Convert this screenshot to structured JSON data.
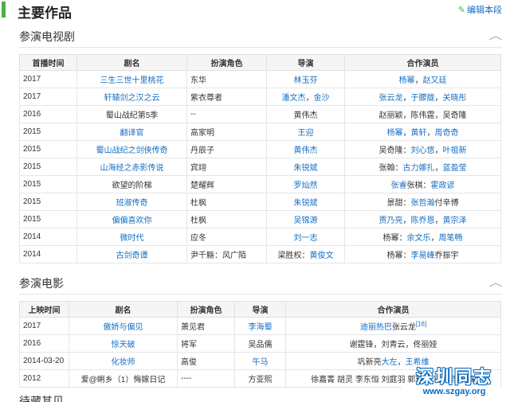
{
  "section_title": "主要作品",
  "edit_label": "编辑本段",
  "tv": {
    "heading": "参演电视剧",
    "headers": [
      "首播时间",
      "剧名",
      "扮演角色",
      "导演",
      "合作演员"
    ],
    "rows": [
      {
        "year": "2017",
        "title": "三生三世十里桃花",
        "title_link": true,
        "role": "东华",
        "director": [
          {
            "t": "林玉芬",
            "l": true
          }
        ],
        "costars": [
          {
            "t": "杨幂",
            "l": true
          },
          {
            "t": "赵又廷",
            "l": true
          }
        ]
      },
      {
        "year": "2017",
        "title": "轩辕剑之汉之云",
        "title_link": true,
        "role": "紫衣尊者",
        "director": [
          {
            "t": "潘文杰",
            "l": true
          },
          {
            "t": "金沙",
            "l": true
          }
        ],
        "costars": [
          {
            "t": "张云龙",
            "l": true
          },
          {
            "t": "于朦胧",
            "l": true
          },
          {
            "t": "关晓彤",
            "l": true
          }
        ]
      },
      {
        "year": "2016",
        "title": "蜀山战纪第5季",
        "title_link": false,
        "role": "--",
        "director": [
          {
            "t": "黄伟杰",
            "l": false
          }
        ],
        "costars": [
          {
            "t": "赵丽颖，陈伟霆，吴奇隆",
            "l": false
          }
        ]
      },
      {
        "year": "2015",
        "title": "翻译官",
        "title_link": true,
        "role": "高家明",
        "director": [
          {
            "t": "王迎",
            "l": true
          }
        ],
        "costars": [
          {
            "t": "杨幂",
            "l": true
          },
          {
            "t": "黄轩",
            "l": true
          },
          {
            "t": "周奇奇",
            "l": true
          }
        ]
      },
      {
        "year": "2015",
        "title": "蜀山战纪之剑侠传奇",
        "title_link": true,
        "role": "丹辰子",
        "director": [
          {
            "t": "黄伟杰",
            "l": true
          }
        ],
        "costars": [
          {
            "t": "吴奇隆：",
            "l": false
          },
          {
            "t": "刘心悠",
            "l": true
          },
          {
            "t": "叶祖新",
            "l": true
          }
        ]
      },
      {
        "year": "2015",
        "title": "山海经之赤影传说",
        "title_link": true,
        "role": "宾翊",
        "director": [
          {
            "t": "朱锐斌",
            "l": true
          }
        ],
        "costars": [
          {
            "t": "张翰：",
            "l": false
          },
          {
            "t": "古力娜扎",
            "l": true
          },
          {
            "t": "蓝盈莹",
            "l": true
          }
        ]
      },
      {
        "year": "2015",
        "title": "欲望的阶梯",
        "title_link": false,
        "role": "楚耀辉",
        "director": [
          {
            "t": "罗灿然",
            "l": true
          }
        ],
        "costars": [
          {
            "t": "张睿",
            "l": true
          },
          {
            "t": "张棋：",
            "l": false
          },
          {
            "t": "霍政谚",
            "l": true
          }
        ]
      },
      {
        "year": "2015",
        "title": "班淑传奇",
        "title_link": true,
        "role": "杜枫",
        "director": [
          {
            "t": "朱锐斌",
            "l": true
          }
        ],
        "costars": [
          {
            "t": "景甜：",
            "l": false
          },
          {
            "t": "张哲瀚",
            "l": true
          },
          {
            "t": "付辛博",
            "l": false
          }
        ]
      },
      {
        "year": "2015",
        "title": "偏偏喜欢你",
        "title_link": true,
        "role": "杜枫",
        "director": [
          {
            "t": "吴锦源",
            "l": true
          }
        ],
        "costars": [
          {
            "t": "贾乃亮",
            "l": true
          },
          {
            "t": "陈乔恩",
            "l": true
          },
          {
            "t": "黄宗泽",
            "l": true
          }
        ]
      },
      {
        "year": "2014",
        "title": "微时代",
        "title_link": true,
        "role": "应冬",
        "director": [
          {
            "t": "刘一志",
            "l": true
          }
        ],
        "costars": [
          {
            "t": "杨幂：",
            "l": false
          },
          {
            "t": "余文乐",
            "l": true
          },
          {
            "t": "周笔畅",
            "l": true
          }
        ]
      },
      {
        "year": "2014",
        "title": "古剑奇谭",
        "title_link": true,
        "role": "尹千觞：风广陌",
        "director": [
          {
            "t": "梁胜权：",
            "l": false
          },
          {
            "t": "黄俊文",
            "l": true
          }
        ],
        "costars": [
          {
            "t": "杨幂：",
            "l": false
          },
          {
            "t": "李易峰",
            "l": true
          },
          {
            "t": "乔振宇",
            "l": false
          }
        ]
      }
    ]
  },
  "film": {
    "heading": "参演电影",
    "headers": [
      "上映时间",
      "剧名",
      "扮演角色",
      "导演",
      "合作演员"
    ],
    "rows": [
      {
        "year": "2017",
        "title": "傲娇与偏见",
        "title_link": true,
        "role": "萧见君",
        "director": [
          {
            "t": "李海蜀",
            "l": true
          }
        ],
        "costars": [
          {
            "t": "迪丽热巴",
            "l": true
          },
          {
            "t": "张云龙",
            "l": false
          }
        ],
        "ref": "[16]"
      },
      {
        "year": "2016",
        "title": "惊天破",
        "title_link": true,
        "role": "将军",
        "director": [
          {
            "t": "吴品儒",
            "l": false
          }
        ],
        "costars": [
          {
            "t": "谢霆锋，刘青云，佟丽娅",
            "l": false
          }
        ]
      },
      {
        "year": "2014-03-20",
        "title": "化妆师",
        "title_link": true,
        "role": "高俊",
        "director": [
          {
            "t": "午马",
            "l": true
          }
        ],
        "costars": [
          {
            "t": "巩新亮",
            "l": false
          },
          {
            "t": "大左",
            "l": true
          },
          {
            "t": "王希维",
            "l": true
          }
        ]
      },
      {
        "year": "2012",
        "title": "爱@蜊乡（1）悔嫁日记",
        "title_link": false,
        "role": "----",
        "director": [
          {
            "t": "方亚熙",
            "l": false
          }
        ],
        "costars": [
          {
            "t": "徐嘉菁 胡灵 李东恒 刘庭羽 郭玮 王钰鑫 李明珠",
            "l": false
          }
        ]
      }
    ]
  },
  "next_section_partial": "待藏其贝",
  "watermark": {
    "title": "深圳同志",
    "url": "www.szgay.org"
  },
  "colors": {
    "link": "#136ec2",
    "accent": "#4fb04a",
    "header_bg": "#f5f5f5"
  },
  "icons": {
    "edit": "pencil-icon",
    "collapse": "chevron-up-icon"
  }
}
